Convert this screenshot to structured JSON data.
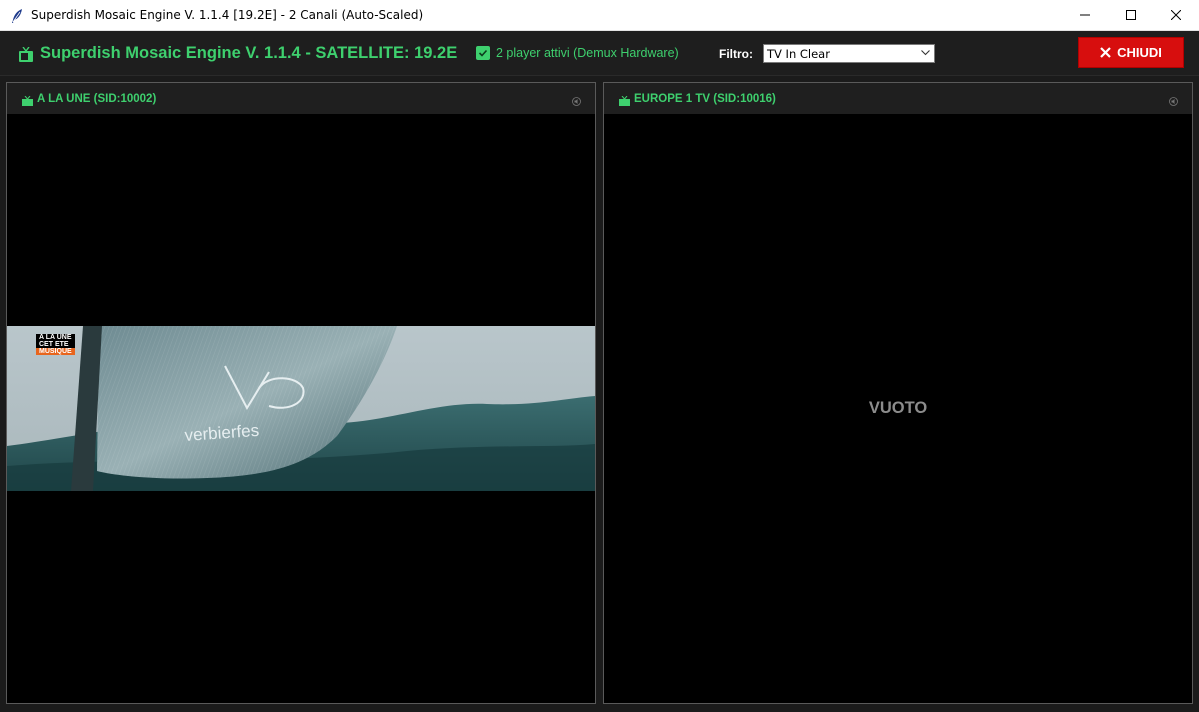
{
  "window": {
    "title": "Superdish Mosaic Engine V. 1.1.4 [19.2E] - 2 Canali (Auto-Scaled)",
    "icon": "feather-icon"
  },
  "header": {
    "app_title": "Superdish Mosaic Engine V. 1.1.4 - SATELLITE: 19.2E",
    "players_checked": true,
    "players_label": "2 player attivi (Demux Hardware)",
    "filter_label": "Filtro:",
    "filter_value": "TV In Clear",
    "close_label": "CHIUDI",
    "accent_color": "#3ed06e",
    "close_color": "#d70e0e"
  },
  "channels": [
    {
      "title": "A LA UNE (SID:10002)",
      "status": "playing",
      "overlay": [
        "A LA UNE",
        "CET ETE",
        "MUSIQUE"
      ],
      "banner_text": "verbierfes"
    },
    {
      "title": "EUROPE 1 TV (SID:10016)",
      "status": "empty",
      "empty_label": "VUOTO"
    }
  ]
}
